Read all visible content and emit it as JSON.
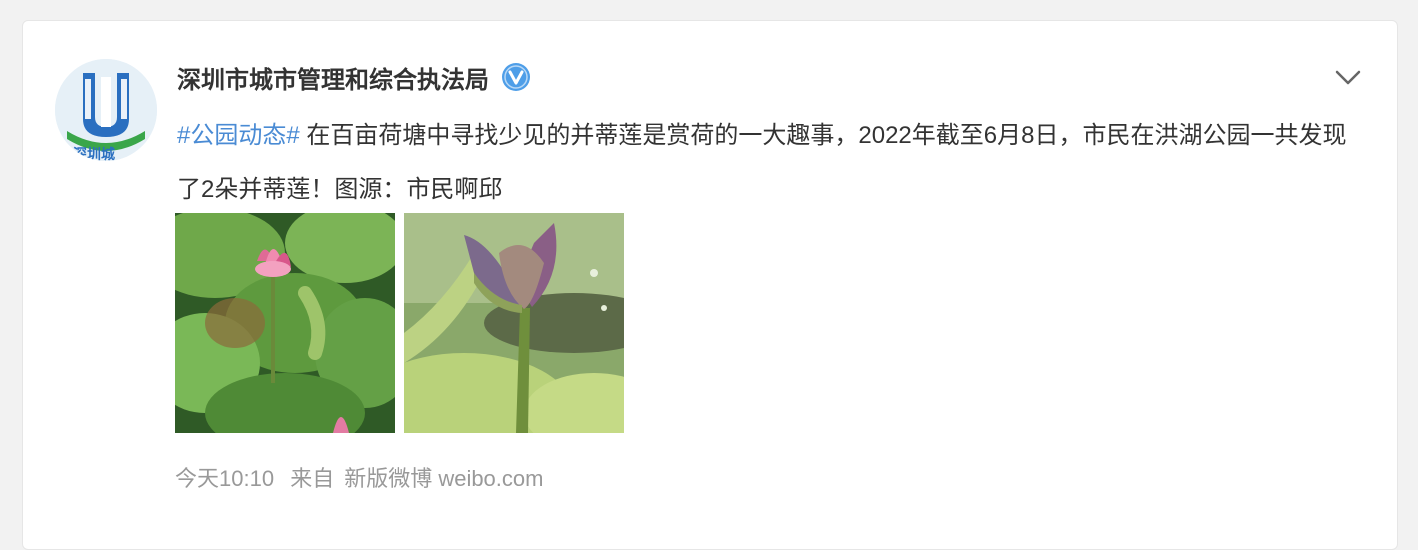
{
  "post": {
    "author": {
      "name": "深圳市城市管理和综合执法局",
      "avatar_text": "深圳城",
      "verified": true,
      "verified_icon": "verified-badge-icon"
    },
    "text": {
      "topic": "#公园动态#",
      "body": " 在百亩荷塘中寻找少见的并蒂莲是赏荷的一大趣事，2022年截至6月8日，市民在洪湖公园一共发现了2朵并蒂莲！图源：市民啊邱"
    },
    "images": [
      {
        "icon": "lotus-flower-photo"
      },
      {
        "icon": "lotus-bud-photo"
      }
    ],
    "meta": {
      "time": "今天10:10",
      "source_prefix": "来自",
      "source": "新版微博 weibo.com"
    },
    "menu_icon": "chevron-down-icon"
  },
  "colors": {
    "topic_link": "#4a8bd4",
    "verified_badge": "#4e9ee8",
    "avatar_blue": "#2a6fc0",
    "avatar_green": "#3aa64a"
  }
}
